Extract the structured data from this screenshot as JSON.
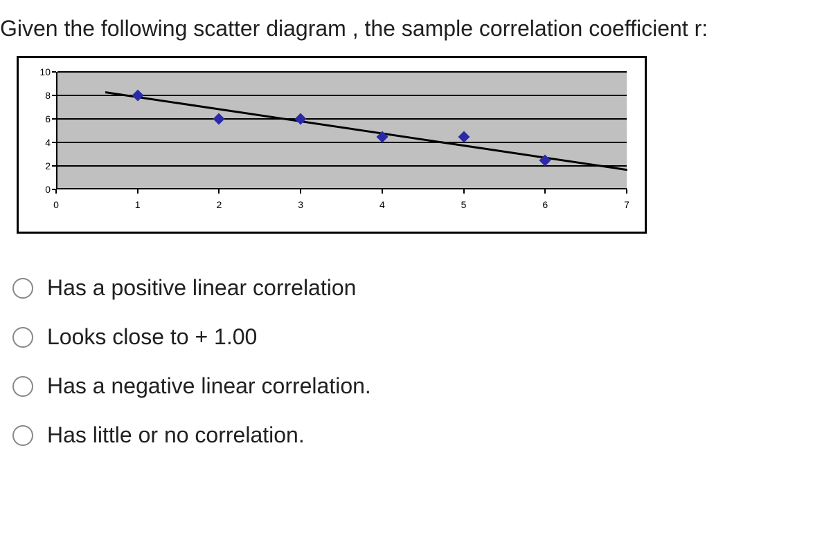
{
  "question": "Given the following scatter diagram , the sample correlation coefficient r:",
  "chart_data": {
    "type": "scatter",
    "x": [
      1,
      2,
      3,
      4,
      5,
      6
    ],
    "y": [
      8,
      6,
      6,
      4.5,
      4.5,
      2.5
    ],
    "trendline": {
      "x0": 0.6,
      "y0": 8.3,
      "x1": 7,
      "y1": 1.7
    },
    "xlim": [
      0,
      7
    ],
    "ylim": [
      0,
      10
    ],
    "x_ticks": [
      0,
      1,
      2,
      3,
      4,
      5,
      6,
      7
    ],
    "y_ticks": [
      0,
      2,
      4,
      6,
      8,
      10
    ],
    "xlabel": "",
    "ylabel": "",
    "grid": true
  },
  "options": [
    {
      "id": "a",
      "label": "Has a positive linear correlation"
    },
    {
      "id": "b",
      "label": "Looks close to + 1.00"
    },
    {
      "id": "c",
      "label": "Has a negative linear correlation."
    },
    {
      "id": "d",
      "label": "Has little or no correlation."
    }
  ]
}
